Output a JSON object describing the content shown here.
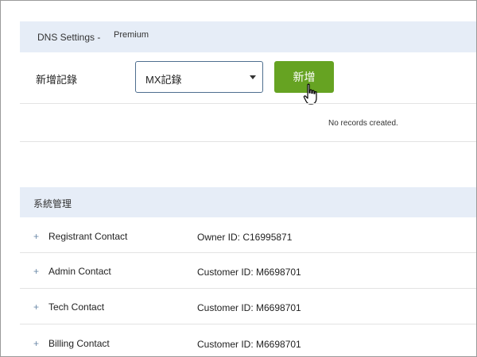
{
  "dns_settings": {
    "title": "DNS Settings -",
    "tier": "Premium"
  },
  "add_record": {
    "label": "新增記錄",
    "record_type_selected": "MX記錄",
    "add_button_label": "新增"
  },
  "records": {
    "empty_message": "No records created."
  },
  "system_management": {
    "title": "系統管理",
    "contacts": [
      {
        "label": "Registrant Contact",
        "id_text": "Owner ID: C16995871"
      },
      {
        "label": "Admin Contact",
        "id_text": "Customer ID: M6698701"
      },
      {
        "label": "Tech Contact",
        "id_text": "Customer ID: M6698701"
      },
      {
        "label": "Billing Contact",
        "id_text": "Customer ID: M6698701"
      }
    ],
    "expand_symbol": "+"
  },
  "icons": {
    "select_caret": "chevron-down-icon",
    "cursor": "hand-pointer-icon",
    "expand": "plus-icon"
  },
  "colors": {
    "header_bg": "#e6edf7",
    "add_button": "#66a322",
    "plus": "#6c8aa8"
  }
}
